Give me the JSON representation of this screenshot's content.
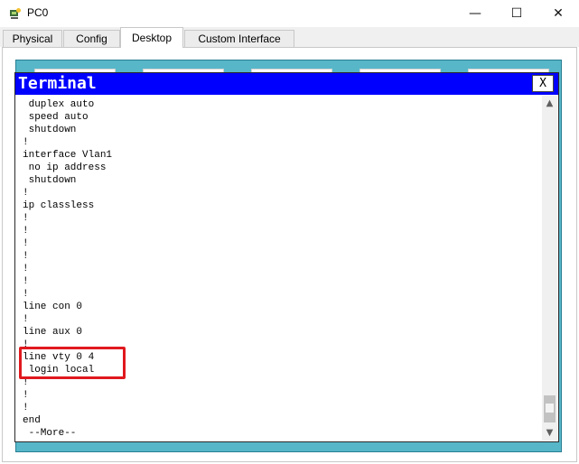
{
  "window": {
    "title": "PC0",
    "icon": "packet-tracer-pc-icon",
    "controls": {
      "minimize": "—",
      "maximize": "☐",
      "close": "✕"
    }
  },
  "tabs": [
    {
      "label": "Physical",
      "active": false
    },
    {
      "label": "Config",
      "active": false
    },
    {
      "label": "Desktop",
      "active": true
    },
    {
      "label": "Custom Interface",
      "active": false
    }
  ],
  "terminal": {
    "title": "Terminal",
    "close_label": "X",
    "lines": [
      " duplex auto",
      " speed auto",
      " shutdown",
      "!",
      "interface Vlan1",
      " no ip address",
      " shutdown",
      "!",
      "ip classless",
      "!",
      "!",
      "!",
      "!",
      "!",
      "!",
      "!",
      "line con 0",
      "!",
      "line aux 0",
      "!",
      "line vty 0 4",
      " login local",
      "!",
      "!",
      "!",
      "end",
      " --More--"
    ],
    "highlight_color": "#e0191e"
  },
  "colors": {
    "terminal_header": "#0000ff",
    "desktop_bg": "#57b7c9"
  }
}
